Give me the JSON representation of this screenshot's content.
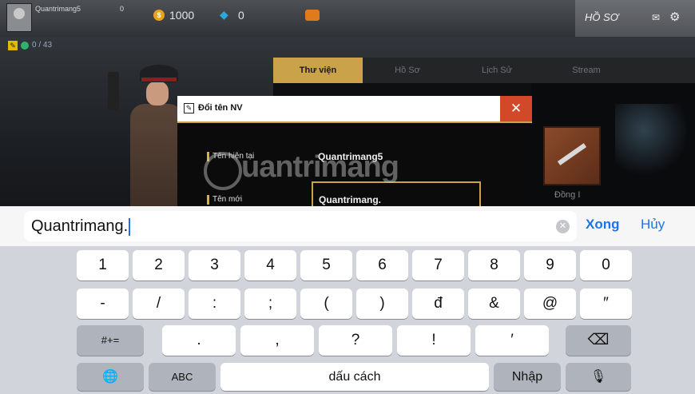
{
  "game": {
    "topbar": {
      "player_name": "Quantrimang5",
      "level": "0",
      "coins": "1000",
      "gems": "0",
      "profile_label": "HỒ SƠ",
      "online_count": "0 / 43"
    },
    "tabs": [
      {
        "label": "Thư viện",
        "active": true
      },
      {
        "label": "Hồ Sơ",
        "active": false
      },
      {
        "label": "Lịch Sử",
        "active": false
      },
      {
        "label": "Stream",
        "active": false
      }
    ],
    "crate_label": "Đồng I",
    "dialog": {
      "title": "Đổi tên NV",
      "close_icon": "✕",
      "current_label": "Tên hiện tại",
      "current_value": "Quantrimang5",
      "new_label": "Tên mới",
      "new_value": "Quantrimang."
    },
    "watermark": "uantrimang"
  },
  "keyboard": {
    "input_value": "Quantrimang.",
    "clear_icon": "✕",
    "done_label": "Xong",
    "cancel_label": "Hủy",
    "row1": [
      "1",
      "2",
      "3",
      "4",
      "5",
      "6",
      "7",
      "8",
      "9",
      "0"
    ],
    "row2": [
      "-",
      "/",
      ":",
      ";",
      "(",
      ")",
      "đ",
      "&",
      "@",
      "″"
    ],
    "row3": {
      "shift_label": "#+=",
      "keys": [
        ".",
        ",",
        "?",
        "!",
        "′"
      ],
      "backspace_icon": "⌫"
    },
    "row4": {
      "globe_icon": "🌐",
      "abc_label": "ABC",
      "space_label": "dấu cách",
      "return_label": "Nhập",
      "mic_icon": "🎙"
    }
  },
  "colors": {
    "accent_gold": "#c9a24a",
    "close_red": "#d2492a",
    "ios_blue": "#1d74e8",
    "keyboard_bg": "#d1d4da"
  }
}
